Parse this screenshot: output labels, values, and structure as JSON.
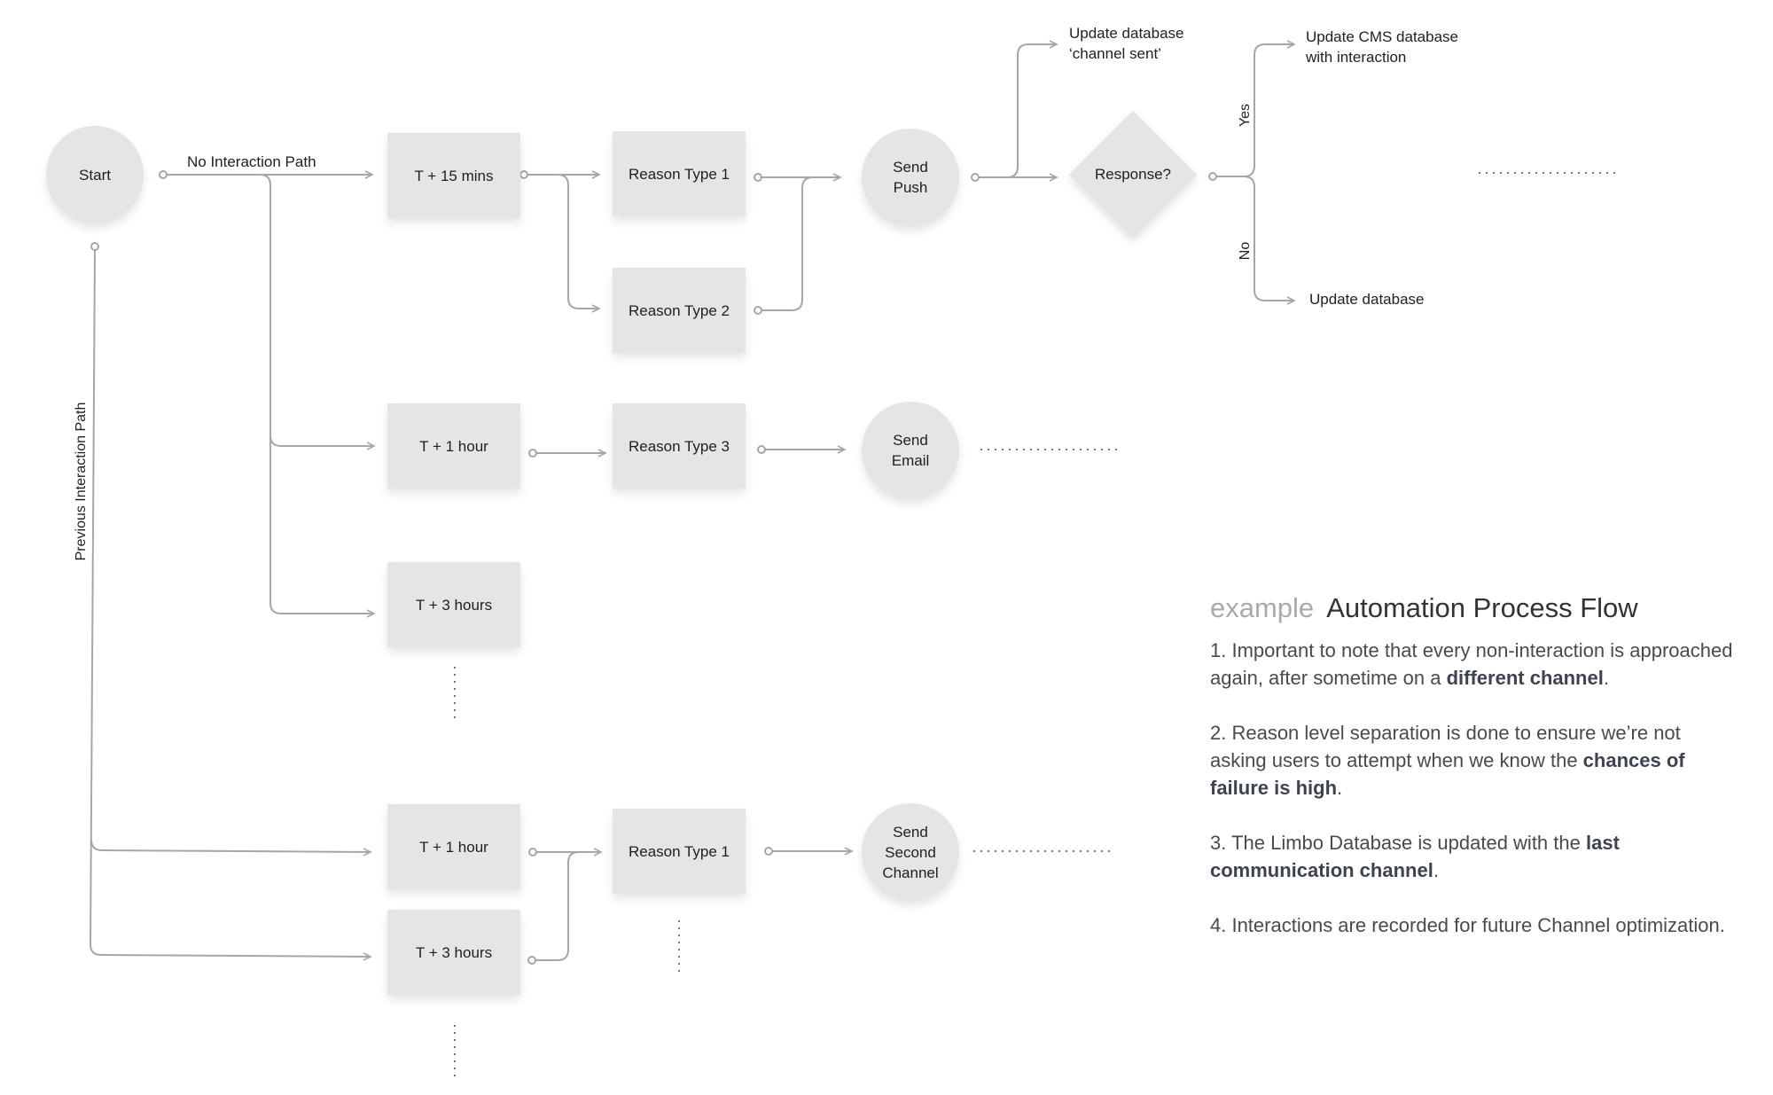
{
  "diagram": {
    "colors": {
      "node_fill": "#e5e5e5",
      "connector": "#a6a6a6",
      "text": "#1f1f1f",
      "notes_text": "#4a4a4a",
      "notes_bold": "#3d4350",
      "title_muted": "#aaaaaa"
    },
    "path_labels": {
      "no_interaction": "No Interaction Path",
      "previous_interaction": "Previous Interaction Path",
      "yes": "Yes",
      "no": "No"
    },
    "nodes": {
      "start": "Start",
      "t15": "T + 15 mins",
      "t1h": "T + 1 hour",
      "t3h": "T + 3 hours",
      "reason1": "Reason Type 1",
      "reason2": "Reason Type 2",
      "reason3": "Reason Type 3",
      "send_push": [
        "Send",
        "Push"
      ],
      "send_email": [
        "Send",
        "Email"
      ],
      "response": "Response?",
      "prev_t1h": "T + 1 hour",
      "prev_t3h": "T + 3 hours",
      "prev_reason1": "Reason Type 1",
      "send_second": [
        "Send",
        "Second",
        "Channel"
      ]
    },
    "outcomes": {
      "channel_sent": [
        "Update database",
        "‘channel sent’"
      ],
      "cms_update": [
        "Update CMS database",
        "with interaction"
      ],
      "update_db": "Update database"
    }
  },
  "notes": {
    "title_prefix": "example",
    "title": "Automation Process Flow",
    "items": [
      {
        "text": "1. Important to note that every non-interaction is approached again, after sometime on a ",
        "bold": "different channel",
        "suffix": "."
      },
      {
        "text": "2. Reason level separation is done to ensure we’re not asking users to attempt when we know the ",
        "bold": "chances of failure is high",
        "suffix": "."
      },
      {
        "text": "3. The Limbo Database is updated with the ",
        "bold": "last communication channel",
        "suffix": "."
      },
      {
        "text": "4. Interactions are recorded for future Channel optimization.",
        "bold": "",
        "suffix": ""
      }
    ]
  }
}
